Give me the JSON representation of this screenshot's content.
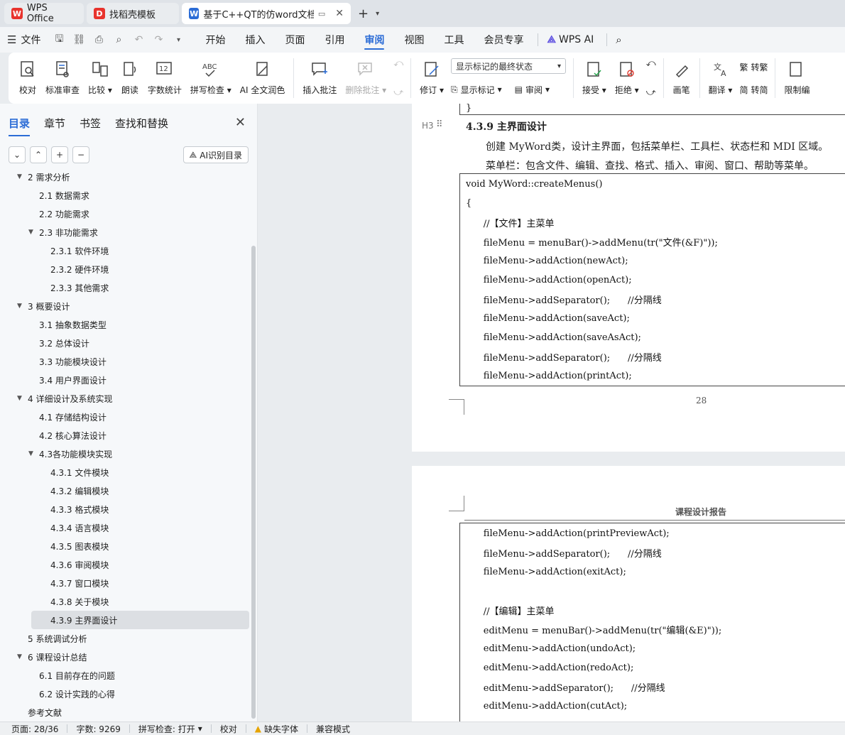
{
  "tabs": [
    {
      "label": "WPS Office",
      "logo": "W",
      "color": "#e8332d"
    },
    {
      "label": "找稻壳模板",
      "logo": "D",
      "color": "#e8332d"
    },
    {
      "label": "基于C++QT的仿word文档编",
      "logo": "W",
      "color": "#2b6cd6"
    }
  ],
  "menubar": {
    "file": "文件",
    "items": [
      "开始",
      "插入",
      "页面",
      "引用",
      "审阅",
      "视图",
      "工具",
      "会员专享"
    ],
    "active": "审阅",
    "ai": "WPS AI"
  },
  "ribbon": {
    "buttons1": [
      "校对",
      "标准审查",
      "比较",
      "朗读",
      "字数统计",
      "拼写检查",
      "AI 全文润色"
    ],
    "insert_comment": "插入批注",
    "delete_comment": "删除批注",
    "revise": "修订",
    "markup_dropdown": "显示标记的最终状态",
    "show_markup": "显示标记",
    "review": "审阅",
    "accept": "接受",
    "reject": "拒绝",
    "pen": "画笔",
    "translate": "翻译",
    "to_traditional": "转繁",
    "to_simplified": "转简",
    "restrict": "限制编"
  },
  "panel": {
    "tabs": [
      "目录",
      "章节",
      "书签",
      "查找和替换"
    ],
    "ai_toc": "AI识别目录",
    "toc": [
      {
        "label": "2  需求分析",
        "level": 1,
        "arrow": "▼"
      },
      {
        "label": "2.1  数据需求",
        "level": 2,
        "arrow": ""
      },
      {
        "label": "2.2  功能需求",
        "level": 2,
        "arrow": ""
      },
      {
        "label": "2.3  非功能需求",
        "level": 2,
        "arrow": "▼"
      },
      {
        "label": "2.3.1  软件环境",
        "level": 3,
        "arrow": ""
      },
      {
        "label": "2.3.2  硬件环境",
        "level": 3,
        "arrow": ""
      },
      {
        "label": "2.3.3  其他需求",
        "level": 3,
        "arrow": ""
      },
      {
        "label": "3  概要设计",
        "level": 1,
        "arrow": "▼"
      },
      {
        "label": "3.1 抽象数据类型",
        "level": 2,
        "arrow": ""
      },
      {
        "label": "3.2  总体设计",
        "level": 2,
        "arrow": ""
      },
      {
        "label": "3.3  功能模块设计",
        "level": 2,
        "arrow": ""
      },
      {
        "label": "3.4  用户界面设计",
        "level": 2,
        "arrow": ""
      },
      {
        "label": "4  详细设计及系统实现",
        "level": 1,
        "arrow": "▼"
      },
      {
        "label": "4.1  存储结构设计",
        "level": 2,
        "arrow": ""
      },
      {
        "label": "4.2  核心算法设计",
        "level": 2,
        "arrow": ""
      },
      {
        "label": "4.3各功能模块实现",
        "level": 2,
        "arrow": "▼"
      },
      {
        "label": "4.3.1  文件模块",
        "level": 3,
        "arrow": ""
      },
      {
        "label": "4.3.2  编辑模块",
        "level": 3,
        "arrow": ""
      },
      {
        "label": "4.3.3  格式模块",
        "level": 3,
        "arrow": ""
      },
      {
        "label": "4.3.4  语言模块",
        "level": 3,
        "arrow": ""
      },
      {
        "label": "4.3.5  图表模块",
        "level": 3,
        "arrow": ""
      },
      {
        "label": "4.3.6  审阅模块",
        "level": 3,
        "arrow": ""
      },
      {
        "label": "4.3.7  窗口模块",
        "level": 3,
        "arrow": ""
      },
      {
        "label": "4.3.8  关于模块",
        "level": 3,
        "arrow": ""
      },
      {
        "label": "4.3.9  主界面设计",
        "level": 3,
        "arrow": "",
        "selected": true
      },
      {
        "label": "5  系统调试分析",
        "level": 1,
        "arrow": ""
      },
      {
        "label": "6  课程设计总结",
        "level": 1,
        "arrow": "▼"
      },
      {
        "label": "6.1  目前存在的问题",
        "level": 2,
        "arrow": ""
      },
      {
        "label": "6.2  设计实践的心得",
        "level": 2,
        "arrow": ""
      },
      {
        "label": "参考文献",
        "level": 1,
        "arrow": ""
      }
    ]
  },
  "document": {
    "heading_marker": "H3",
    "heading": "4.3.9  主界面设计",
    "para1": "创建 MyWord类，设计主界面，包括菜单栏、工具栏、状态栏和 MDI 区域。",
    "para2": "菜单栏：包含文件、编辑、查找、格式、插入、审阅、窗口、帮助等菜单。",
    "page_number": "28",
    "header_text": "课程设计报告",
    "box_top_char": "}",
    "code1": [
      "void MyWord::createMenus()",
      "{",
      "      //【文件】主菜单",
      "      fileMenu = menuBar()->addMenu(tr(\"文件(&F)\"));",
      "      fileMenu->addAction(newAct);",
      "      fileMenu->addAction(openAct);",
      "      fileMenu->addSeparator();      //分隔线",
      "      fileMenu->addAction(saveAct);",
      "      fileMenu->addAction(saveAsAct);",
      "      fileMenu->addSeparator();      //分隔线",
      "      fileMenu->addAction(printAct);"
    ],
    "code2": [
      "      fileMenu->addAction(printPreviewAct);",
      "      fileMenu->addSeparator();      //分隔线",
      "      fileMenu->addAction(exitAct);",
      "",
      "      //【编辑】主菜单",
      "      editMenu = menuBar()->addMenu(tr(\"编辑(&E)\"));",
      "      editMenu->addAction(undoAct);",
      "      editMenu->addAction(redoAct);",
      "      editMenu->addSeparator();      //分隔线",
      "      editMenu->addAction(cutAct);"
    ]
  },
  "status": {
    "page": "页面: 28/36",
    "words": "字数: 9269",
    "spell": "拼写检查: 打开",
    "proof": "校对",
    "missing_font": "缺失字体",
    "compat": "兼容模式"
  }
}
